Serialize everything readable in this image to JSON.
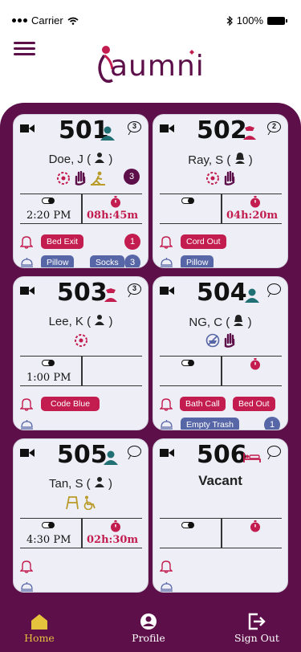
{
  "status_bar": {
    "carrier": "Carrier",
    "battery": "100%"
  },
  "app": {
    "logo_text": "aumni"
  },
  "colors": {
    "brand": "#5d0f49",
    "alert_red": "#c21d4e",
    "chip_blue": "#5766a6",
    "gold": "#b99b27",
    "card_bg": "#eeeef7",
    "teal": "#1f6f73"
  },
  "rooms": [
    {
      "number": "501",
      "patient": "Doe, J (",
      "paren": ")",
      "count_badge": "3",
      "status_count": "3",
      "med_time": "2:20 PM",
      "timer": "08h:45m",
      "alerts": [
        "Bed Exit"
      ],
      "alert_count": "1",
      "requests": [
        "Pillow",
        "Socks"
      ],
      "request_count": "3"
    },
    {
      "number": "502",
      "patient": "Ray, S (",
      "paren": ")",
      "count_badge": "2",
      "med_time": "",
      "timer": "04h:20m",
      "alerts": [
        "Cord Out"
      ],
      "requests": [
        "Pillow"
      ]
    },
    {
      "number": "503",
      "patient": "Lee, K (",
      "paren": ")",
      "count_badge": "3",
      "med_time": "1:00 PM",
      "timer": "",
      "alerts": [
        "Code Blue"
      ],
      "requests": []
    },
    {
      "number": "504",
      "patient": "NG, C (",
      "paren": ")",
      "med_time": "",
      "timer": "",
      "alerts": [
        "Bath Call",
        "Bed Out"
      ],
      "requests": [
        "Empty Trash"
      ],
      "request_count": "1"
    },
    {
      "number": "505",
      "patient": "Tan, S (",
      "paren": ")",
      "med_time": "4:30 PM",
      "timer": "02h:30m",
      "alerts": [],
      "requests": []
    },
    {
      "number": "506",
      "patient": "Vacant",
      "med_time": "",
      "timer": "",
      "alerts": [],
      "requests": []
    }
  ],
  "nav": {
    "home": "Home",
    "profile": "Profile",
    "sign_out": "Sign Out"
  },
  "icons": [
    "menu-icon",
    "video-camera-icon",
    "chat-bubble-icon",
    "nurse-icon",
    "person-icon",
    "pill-icon",
    "stopwatch-icon",
    "bell-icon",
    "service-bell-icon",
    "home-icon",
    "profile-icon",
    "sign-out-icon",
    "bed-icon"
  ]
}
